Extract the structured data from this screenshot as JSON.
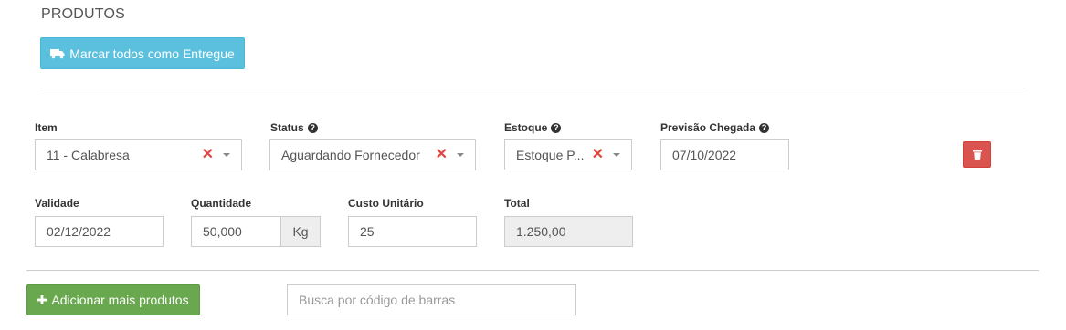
{
  "section": {
    "title": "PRODUTOS"
  },
  "mark_all": {
    "label": "Marcar todos como Entregue",
    "icon": "truck-icon"
  },
  "product": {
    "item": {
      "label": "Item",
      "value": "11 - Calabresa"
    },
    "status": {
      "label": "Status",
      "value": "Aguardando Fornecedor"
    },
    "estoque": {
      "label": "Estoque",
      "value": "Estoque P..."
    },
    "previsao": {
      "label": "Previsão Chegada",
      "value": "07/10/2022"
    },
    "validade": {
      "label": "Validade",
      "value": "02/12/2022"
    },
    "quantidade": {
      "label": "Quantidade",
      "value": "50,000",
      "unit": "Kg"
    },
    "custo": {
      "label": "Custo Unitário",
      "value": "25"
    },
    "total": {
      "label": "Total",
      "value": "1.250,00"
    },
    "delete_icon": "trash-icon"
  },
  "add_more": {
    "label": "Adicionar mais produtos",
    "icon": "plus-icon"
  },
  "barcode_search": {
    "placeholder": "Busca por código de barras"
  },
  "colors": {
    "info": "#5bc0de",
    "success": "#6aa84f",
    "danger": "#d9534f",
    "clear": "#e0443e"
  }
}
